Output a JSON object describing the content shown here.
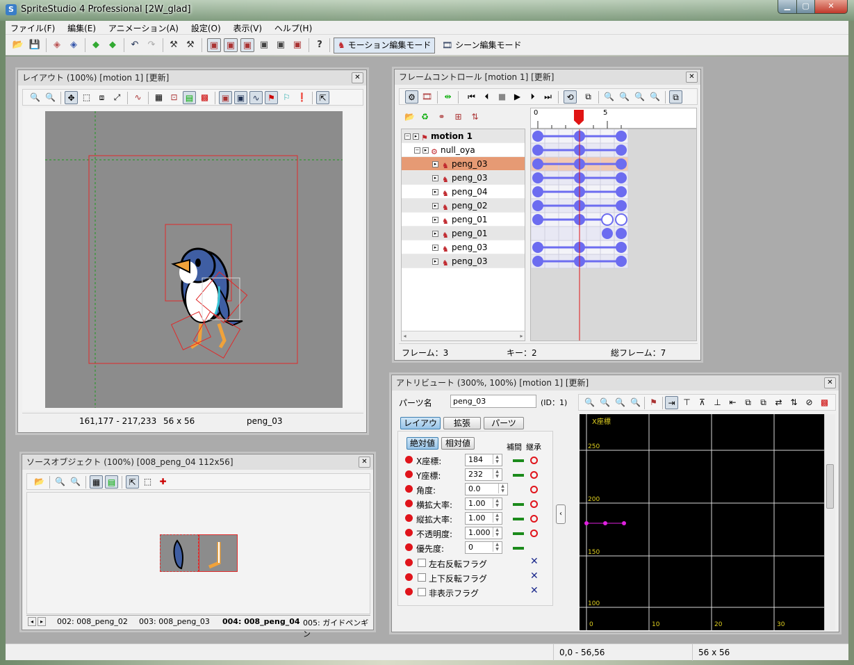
{
  "app": {
    "title": "SpriteStudio 4 Professional [2W_glad]",
    "icon_label": "S"
  },
  "menu": [
    "ファイル(F)",
    "編集(E)",
    "アニメーション(A)",
    "設定(O)",
    "表示(V)",
    "ヘルプ(H)"
  ],
  "toolbar": {
    "motion_mode": "モーション編集モード",
    "scene_mode": "シーン編集モード"
  },
  "layout_window": {
    "title": "レイアウト (100%) [motion 1] [更新]",
    "status": {
      "coords": "161,177 - 217,233",
      "size": "56 x 56",
      "part": "peng_03"
    }
  },
  "frame_window": {
    "title": "フレームコントロール [motion 1] [更新]",
    "ruler": [
      "0",
      "5"
    ],
    "tree": [
      {
        "label": "motion 1",
        "bold": true
      },
      {
        "label": "null_oya"
      },
      {
        "label": "peng_03",
        "selected": true
      },
      {
        "label": "peng_03"
      },
      {
        "label": "peng_04"
      },
      {
        "label": "peng_02"
      },
      {
        "label": "peng_01"
      },
      {
        "label": "peng_01"
      },
      {
        "label": "peng_03"
      },
      {
        "label": "peng_03"
      }
    ],
    "status": {
      "frame": "フレーム：3",
      "key": "キー：2",
      "total": "総フレーム：7"
    },
    "current_frame": 3
  },
  "source_window": {
    "title": "ソースオブジェクト (100%) [008_peng_04  112x56]",
    "tabs": [
      "002: 008_peng_02",
      "003: 008_peng_03",
      "004: 008_peng_04",
      "005: ガイドペンギン"
    ],
    "active_tab": 2
  },
  "attr_window": {
    "title": "アトリビュート (300%, 100%) [motion 1] [更新]",
    "part_label": "パーツ名",
    "part_value": "peng_03",
    "id_label": "(ID：1)",
    "tabs": [
      "レイアウト",
      "拡張",
      "パーツ"
    ],
    "subtabs": [
      "絶対値",
      "相対値"
    ],
    "col_interp": "補間",
    "col_inherit": "継承",
    "rows": [
      {
        "label": "X座標:",
        "value": "184"
      },
      {
        "label": "Y座標:",
        "value": "232"
      },
      {
        "label": "角度:",
        "value": "0.0"
      },
      {
        "label": "横拡大率:",
        "value": "1.00"
      },
      {
        "label": "縦拡大率:",
        "value": "1.00"
      },
      {
        "label": "不透明度:",
        "value": "1.000"
      },
      {
        "label": "優先度:",
        "value": "0"
      }
    ],
    "flags": [
      "左右反転フラグ",
      "上下反転フラグ",
      "非表示フラグ"
    ],
    "graph": {
      "label": "X座標",
      "y_ticks": [
        "250",
        "200",
        "150",
        "100"
      ],
      "x_ticks": [
        "0",
        "10",
        "20",
        "30"
      ]
    }
  },
  "statusbar": {
    "range": "0,0 - 56,56",
    "size": "56 x 56"
  }
}
